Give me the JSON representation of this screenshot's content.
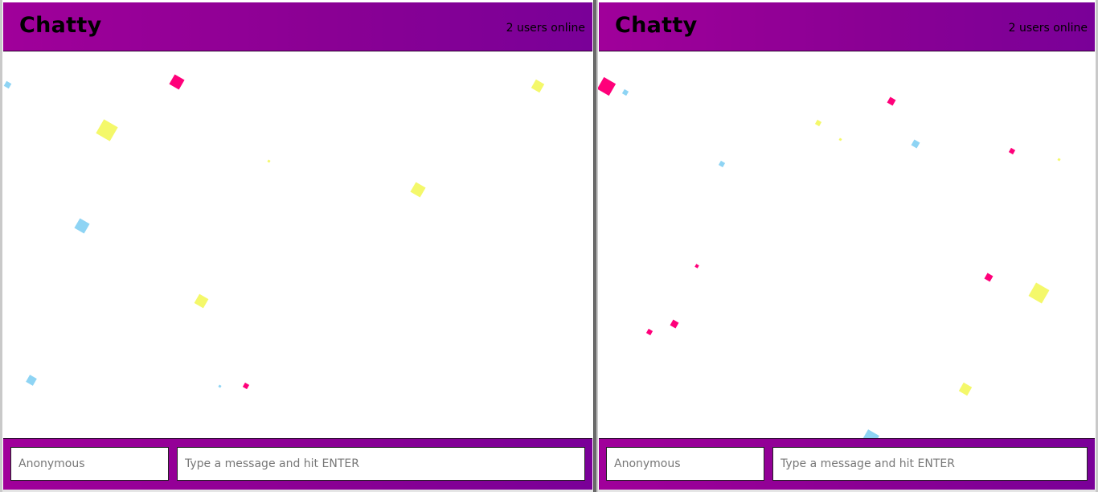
{
  "chat_windows": [
    {
      "app_title": "Chatty",
      "online_status": "2 users online",
      "username_placeholder": "Anonymous",
      "message_placeholder": "Type a message and hit ENTER"
    },
    {
      "app_title": "Chatty",
      "online_status": "2 users online",
      "username_placeholder": "Anonymous",
      "message_placeholder": "Type a message and hit ENTER"
    }
  ],
  "colors": {
    "header_gradient_start": "#a0009a",
    "header_gradient_end": "#7a0098",
    "confetti_pink": "#ff007a",
    "confetti_yellow": "#f4f86a",
    "confetti_blue": "#8ed4f4"
  }
}
